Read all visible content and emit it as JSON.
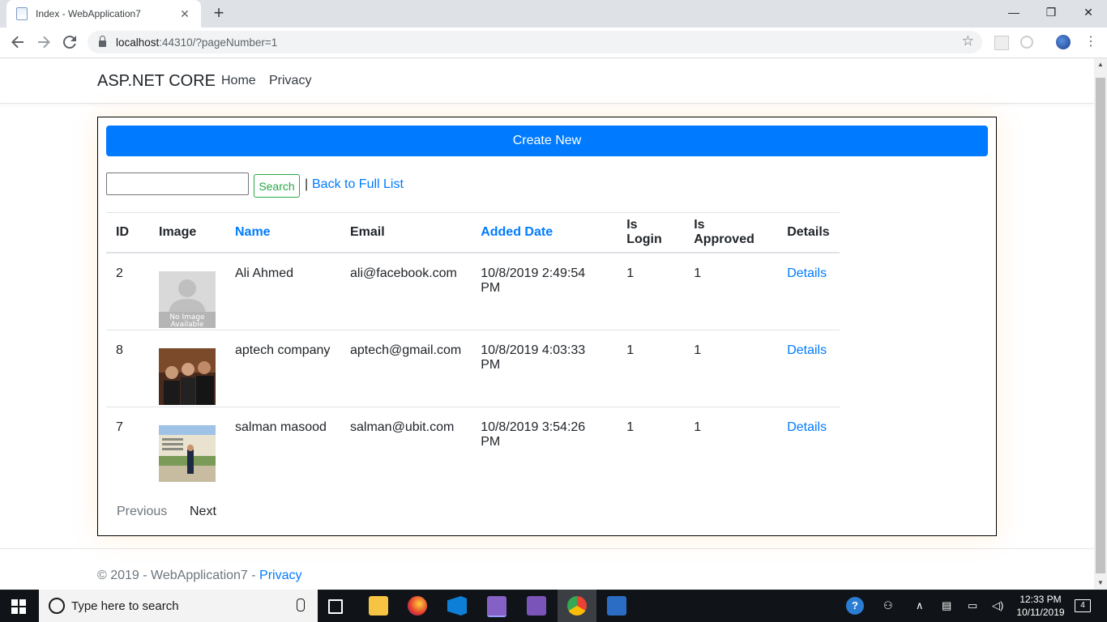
{
  "browser": {
    "tab_title": "Index - WebApplication7",
    "close_glyph": "✕",
    "new_tab_glyph": "+",
    "url_host": "localhost",
    "url_rest": ":44310/?pageNumber=1",
    "window_controls": [
      "—",
      "❐",
      "✕"
    ]
  },
  "navbar": {
    "brand": "ASP.NET CORE",
    "links": [
      "Home",
      "Privacy"
    ]
  },
  "main": {
    "create_label": "Create New",
    "search_button": "Search",
    "separator": "|",
    "back_link": "Back to Full List",
    "table": {
      "headers": [
        "ID",
        "Image",
        "Name",
        "Email",
        "Added Date",
        "Is Login",
        "Is Approved",
        "Details"
      ],
      "sortable_headers": [
        "Name",
        "Added Date"
      ],
      "rows": [
        {
          "id": "2",
          "image": "no-image-placeholder",
          "name": "Ali Ahmed",
          "email": "ali@facebook.com",
          "added": "10/8/2019 2:49:54 PM",
          "is_login": "1",
          "is_approved": "1",
          "details": "Details"
        },
        {
          "id": "8",
          "image": "group-photo",
          "name": "aptech company",
          "email": "aptech@gmail.com",
          "added": "10/8/2019 4:03:33 PM",
          "is_login": "1",
          "is_approved": "1",
          "details": "Details"
        },
        {
          "id": "7",
          "image": "building-photo",
          "name": "salman masood",
          "email": "salman@ubit.com",
          "added": "10/8/2019 3:54:26 PM",
          "is_login": "1",
          "is_approved": "1",
          "details": "Details"
        }
      ],
      "no_image_text": [
        "No Image",
        "Available"
      ]
    },
    "pager": {
      "previous": "Previous",
      "next": "Next"
    }
  },
  "footer": {
    "copyright": "© 2019 - WebApplication7 - ",
    "privacy": "Privacy"
  },
  "taskbar": {
    "search_placeholder": "Type here to search",
    "time": "12:33 PM",
    "date": "10/11/2019",
    "notification_count": "4"
  },
  "colors": {
    "primary": "#007bff",
    "success": "#28a745",
    "taskbar": "#101418"
  }
}
